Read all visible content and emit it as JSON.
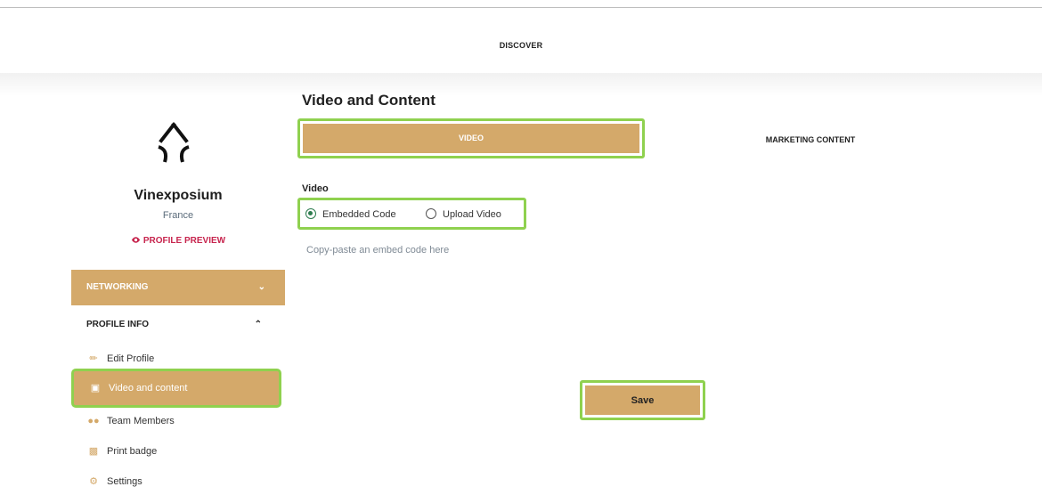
{
  "topnav": {
    "discover_label": "DISCOVER"
  },
  "profile": {
    "company_name": "Vinexposium",
    "country": "France",
    "preview_label": "PROFILE PREVIEW"
  },
  "sidebar": {
    "networking_label": "NETWORKING",
    "profile_info_label": "PROFILE INFO",
    "items": [
      {
        "label": "Edit Profile",
        "icon": "pencil-icon"
      },
      {
        "label": "Video and content",
        "icon": "media-icon",
        "active": true
      },
      {
        "label": "Team Members",
        "icon": "people-icon"
      },
      {
        "label": "Print badge",
        "icon": "printer-icon"
      },
      {
        "label": "Settings",
        "icon": "gear-icon"
      }
    ]
  },
  "main": {
    "title": "Video and Content",
    "tabs": [
      {
        "label": "VIDEO",
        "active": true
      },
      {
        "label": "MARKETING CONTENT",
        "active": false
      }
    ],
    "video_section_label": "Video",
    "radio_options": [
      {
        "label": "Embedded Code",
        "checked": true
      },
      {
        "label": "Upload Video",
        "checked": false
      }
    ],
    "embed_placeholder": "Copy-paste an embed code here",
    "save_label": "Save"
  },
  "colors": {
    "accent": "#d4a96a",
    "highlight_outline": "#8fd14f",
    "preview_link": "#c7254e",
    "radio_checked": "#2e7d4f"
  }
}
